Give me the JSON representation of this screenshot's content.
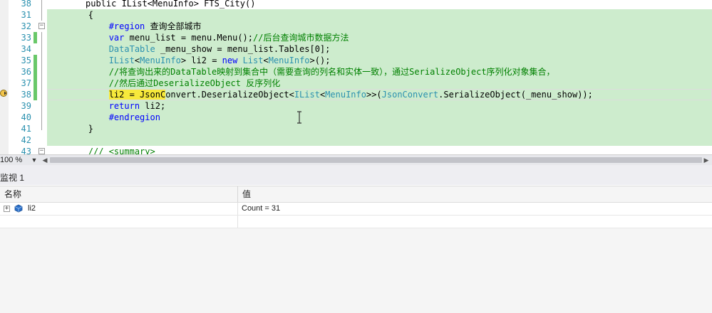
{
  "editor": {
    "top_line_partial": "public IList<MenuInfo> FTS_City()",
    "top_right_partial": "__ ,",
    "lines": [
      {
        "num": "31",
        "outline": "line",
        "changed": false,
        "segments": [
          {
            "t": "        {",
            "c": ""
          }
        ]
      },
      {
        "num": "32",
        "outline": "minus",
        "changed": false,
        "segments": [
          {
            "t": "            #region ",
            "c": "kw"
          },
          {
            "t": "查询全部城市",
            "c": ""
          }
        ]
      },
      {
        "num": "33",
        "outline": "line",
        "changed": true,
        "segments": [
          {
            "t": "            ",
            "c": ""
          },
          {
            "t": "var",
            "c": "kw"
          },
          {
            "t": " menu_list = menu.Menu();",
            "c": ""
          },
          {
            "t": "//后台查询城市数据方法",
            "c": "cm"
          }
        ]
      },
      {
        "num": "34",
        "outline": "line",
        "changed": false,
        "segments": [
          {
            "t": "            ",
            "c": ""
          },
          {
            "t": "DataTable",
            "c": "ty"
          },
          {
            "t": " _menu_show = menu_list.Tables[0];",
            "c": ""
          }
        ]
      },
      {
        "num": "35",
        "outline": "line",
        "changed": true,
        "segments": [
          {
            "t": "            ",
            "c": ""
          },
          {
            "t": "IList",
            "c": "ty"
          },
          {
            "t": "<",
            "c": ""
          },
          {
            "t": "MenuInfo",
            "c": "ty"
          },
          {
            "t": "> li2 = ",
            "c": ""
          },
          {
            "t": "new",
            "c": "kw"
          },
          {
            "t": " ",
            "c": ""
          },
          {
            "t": "List",
            "c": "ty"
          },
          {
            "t": "<",
            "c": ""
          },
          {
            "t": "MenuInfo",
            "c": "ty"
          },
          {
            "t": ">();",
            "c": ""
          }
        ]
      },
      {
        "num": "36",
        "outline": "line",
        "changed": true,
        "segments": [
          {
            "t": "            //将查询出来的DataTable映射到集合中（需要查询的列名和实体一致），通过SerializeObject序列化对象集合，",
            "c": "cm"
          }
        ]
      },
      {
        "num": "37",
        "outline": "line",
        "changed": true,
        "segments": [
          {
            "t": "            //然后通过DeserializeObject 反序列化",
            "c": "cm"
          }
        ]
      },
      {
        "num": "38",
        "outline": "line",
        "changed": true,
        "current": true,
        "segments": [
          {
            "t": "            ",
            "c": ""
          },
          {
            "t": "li2 = JsonC",
            "c": "hl"
          },
          {
            "t": "onvert.DeserializeObject<",
            "c": ""
          },
          {
            "t": "IList",
            "c": "ty"
          },
          {
            "t": "<",
            "c": ""
          },
          {
            "t": "MenuInfo",
            "c": "ty"
          },
          {
            "t": ">>(",
            "c": ""
          },
          {
            "t": "JsonConvert",
            "c": "ty"
          },
          {
            "t": ".SerializeObject(_menu_show));",
            "c": ""
          }
        ]
      },
      {
        "num": "39",
        "outline": "line",
        "changed": false,
        "segments": [
          {
            "t": "            ",
            "c": ""
          },
          {
            "t": "return",
            "c": "kw"
          },
          {
            "t": " li2;",
            "c": ""
          }
        ]
      },
      {
        "num": "40",
        "outline": "line",
        "changed": false,
        "segments": [
          {
            "t": "            #endregion",
            "c": "kw"
          }
        ]
      },
      {
        "num": "41",
        "outline": "end",
        "changed": false,
        "segments": [
          {
            "t": "        }",
            "c": ""
          }
        ]
      },
      {
        "num": "42",
        "outline": "none",
        "changed": false,
        "segments": [
          {
            "t": "",
            "c": ""
          }
        ]
      },
      {
        "num": "43",
        "outline": "minus",
        "changed": false,
        "segments": [
          {
            "t": "        /// <summary>",
            "c": "cm"
          }
        ]
      }
    ]
  },
  "zoom": {
    "value": "100 %"
  },
  "watch": {
    "title": "监视 1",
    "columns": {
      "name": "名称",
      "value": "值"
    },
    "rows": [
      {
        "name": "li2",
        "value": "Count = 31",
        "expander": "+"
      }
    ]
  },
  "colors": {
    "code_bg": "#cdeccd",
    "change_marker": "#69c869",
    "keyword": "#0000ff",
    "type": "#2b91af",
    "comment": "#008000",
    "highlight": "#f7e93b"
  }
}
